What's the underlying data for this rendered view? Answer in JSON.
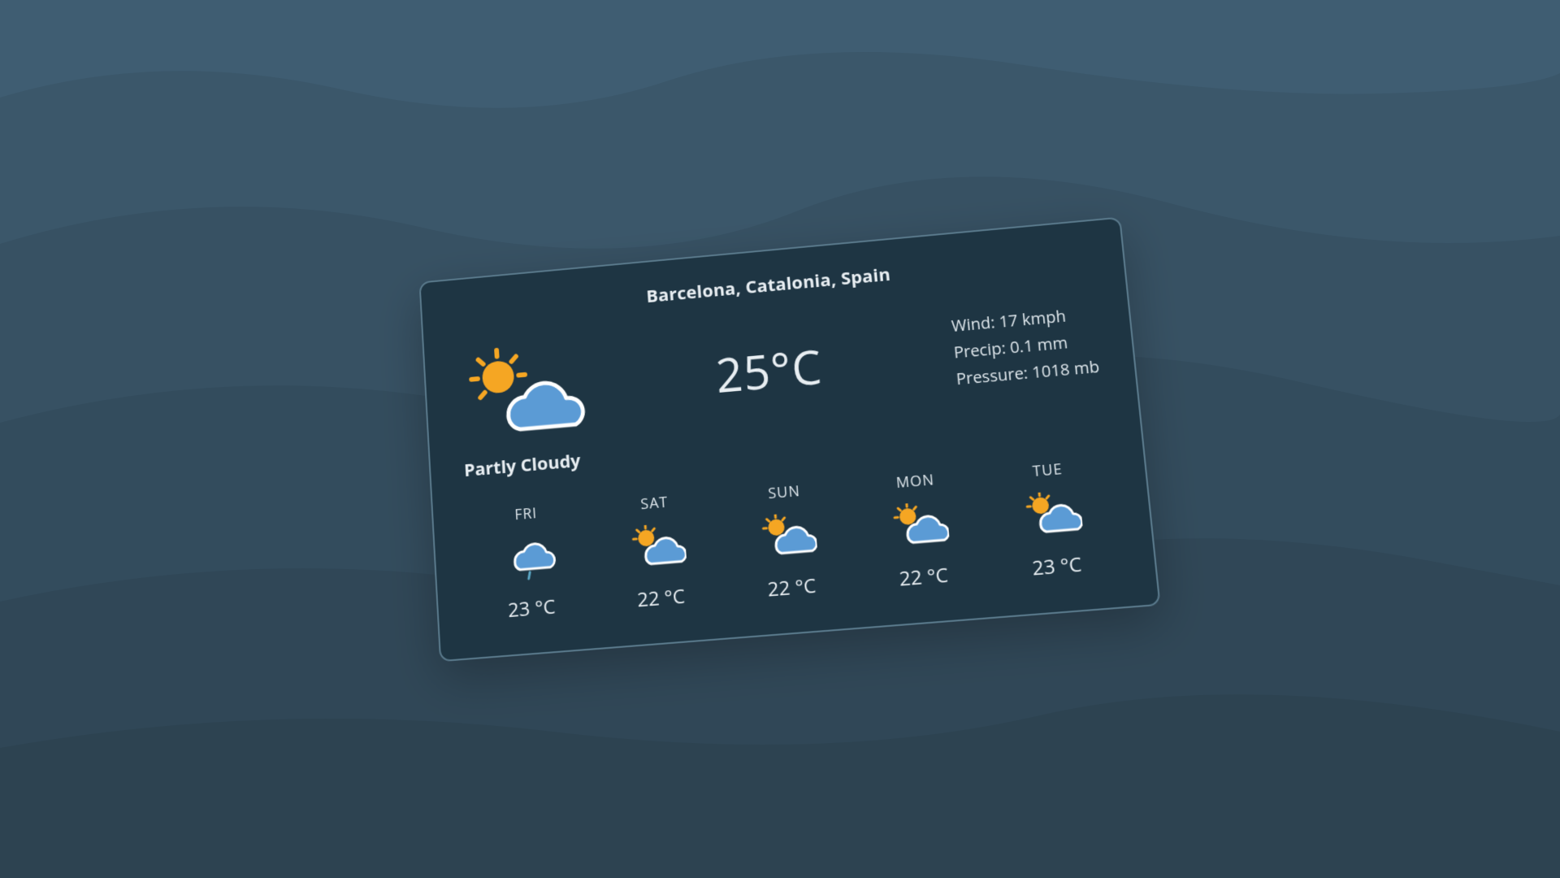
{
  "location": "Barcelona, Catalonia, Spain",
  "current": {
    "condition": "Partly Cloudy",
    "temperature": "25°C",
    "wind": "Wind: 17 kmph",
    "precip": "Precip: 0.1 mm",
    "pressure": "Pressure: 1018 mb",
    "icon": "partly-cloudy"
  },
  "forecast": [
    {
      "day": "FRI",
      "temp": "23 °C",
      "icon": "light-rain"
    },
    {
      "day": "SAT",
      "temp": "22 °C",
      "icon": "partly-cloudy"
    },
    {
      "day": "SUN",
      "temp": "22 °C",
      "icon": "partly-cloudy"
    },
    {
      "day": "MON",
      "temp": "22 °C",
      "icon": "partly-cloudy"
    },
    {
      "day": "TUE",
      "temp": "23 °C",
      "icon": "partly-cloudy"
    }
  ],
  "colors": {
    "card_bg": "#1e3543",
    "card_border": "#5a7a8c",
    "sun": "#f5a623",
    "cloud": "#5b9bd5",
    "cloud_stroke": "#ffffff",
    "rain": "#5ba7c5"
  }
}
